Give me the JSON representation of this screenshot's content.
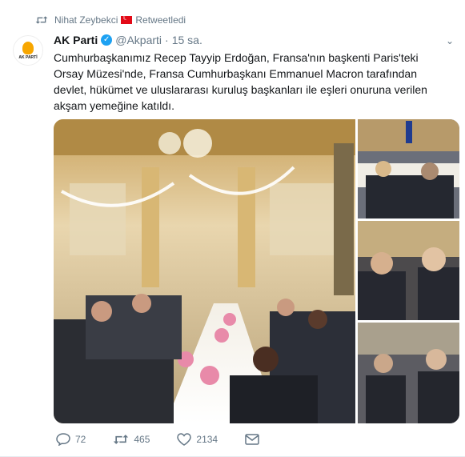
{
  "retweet": {
    "user": "Nihat Zeybekci",
    "label": "Retweetledi"
  },
  "author": {
    "name": "AK Parti",
    "handle": "@Akparti",
    "separator": "·",
    "time": "15 sa.",
    "avatar_text": "AK PARTİ"
  },
  "tweet_text": "Cumhurbaşkanımız Recep Tayyip Erdoğan, Fransa'nın başkenti Paris'teki Orsay Müzesi'nde, Fransa Cumhurbaşkanı Emmanuel Macron tarafından devlet, hükümet ve uluslararası kuruluş başkanları ile eşleri onuruna verilen akşam yemeğine katıldı.",
  "actions": {
    "replies": "72",
    "retweets": "465",
    "likes": "2134"
  },
  "icons": [
    "retweet-icon",
    "turkey-flag-icon",
    "verified-icon",
    "chevron-down-icon",
    "reply-icon",
    "like-icon",
    "direct-message-icon"
  ],
  "colors": {
    "accent": "#1da1f2",
    "muted": "#657786",
    "flag": "#e30a17",
    "logo": "#f7a600"
  }
}
